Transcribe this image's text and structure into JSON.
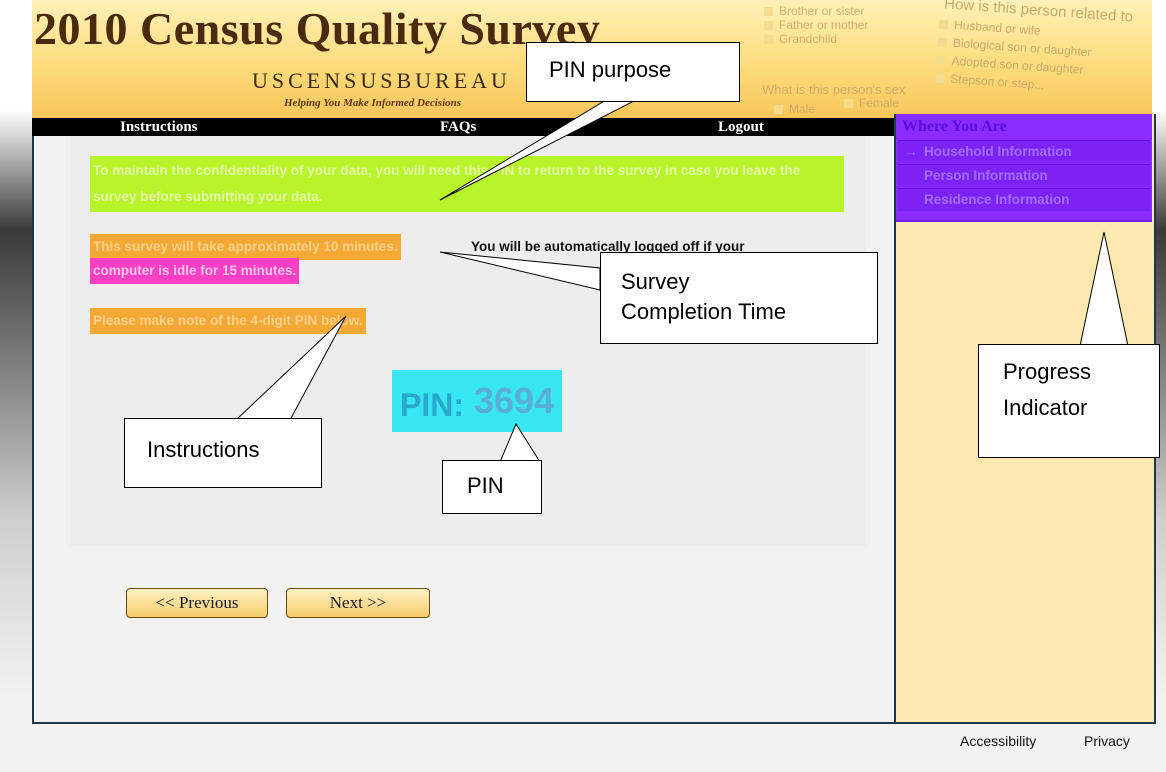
{
  "header": {
    "title": "2010 Census Quality Survey",
    "bureau": "USCENSUSBUREAU",
    "tagline": "Helping You Make Informed Decisions",
    "background_form": {
      "left_options": [
        "Brother or sister",
        "Father or mother",
        "Grandchild"
      ],
      "sex_question": "What is this person's sex",
      "sex_options": [
        "Male",
        "Female"
      ],
      "relation_question": "How is this person related to",
      "relation_options": [
        "Husband or wife",
        "Biological son or daughter",
        "Adopted son or daughter",
        "Stepson or step..."
      ]
    }
  },
  "nav": {
    "instructions": "Instructions",
    "faqs": "FAQs",
    "logout": "Logout"
  },
  "content": {
    "pin_purpose_text": "To maintain the confidentiality of your data, you will need this PIN to return to the survey in case you leave the survey before submitting your data.",
    "survey_time_text": "This survey will take approximately 10 minutes.",
    "logoff_text_a": "You will be automatically logged off if your",
    "logoff_text_b": "computer is idle for 15 minutes.",
    "note_text": "Please make note of the 4-digit PIN below.",
    "pin_label": "PIN:",
    "pin_value": "3694"
  },
  "buttons": {
    "previous": "<< Previous",
    "next": "Next >>"
  },
  "progress": {
    "title": "Where You Are",
    "current_marker": "→",
    "steps": [
      "Household Information",
      "Person Information",
      "Residence Information"
    ]
  },
  "footer": {
    "accessibility": "Accessibility",
    "privacy": "Privacy"
  },
  "callouts": {
    "pin_purpose": "PIN purpose",
    "completion_time_line1": "Survey",
    "completion_time_line2": "Completion Time",
    "instructions": "Instructions",
    "pin": "PIN",
    "progress_line1": "Progress",
    "progress_line2": "Indicator"
  },
  "colors": {
    "highlight_green": "#b7f42a",
    "highlight_orange": "#f5a935",
    "highlight_magenta": "#ff3fc4",
    "highlight_cyan": "#36e6f3",
    "highlight_purple": "#8a2cff",
    "header_gold": "#fddc7c"
  }
}
